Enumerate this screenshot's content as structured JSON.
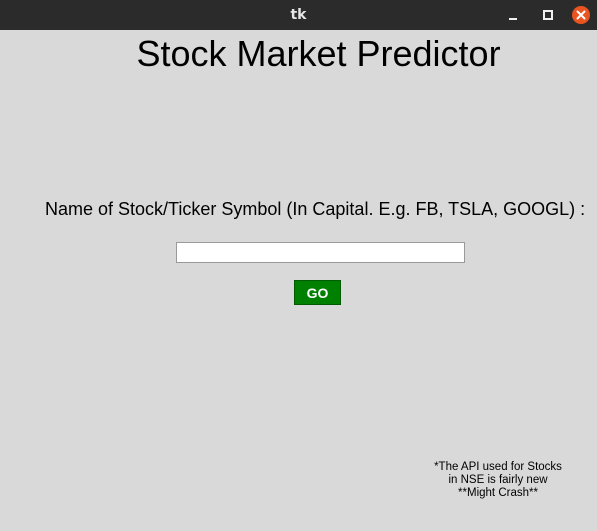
{
  "window": {
    "title": "tk"
  },
  "app": {
    "heading": "Stock Market Predictor",
    "prompt_label": "Name of Stock/Ticker Symbol (In Capital. E.g. FB, TSLA, GOOGL) :",
    "ticker_input": {
      "value": "",
      "placeholder": ""
    },
    "go_button_label": "GO",
    "footnote": {
      "line1": "*The API used for Stocks",
      "line2": "in NSE is fairly new",
      "line3": "**Might Crash**"
    }
  },
  "colors": {
    "background": "#d9d9d9",
    "titlebar": "#2b2b2b",
    "go_button": "#008000",
    "close_button": "#e95420"
  },
  "icons": [
    "minimize-icon",
    "maximize-icon",
    "close-icon"
  ]
}
